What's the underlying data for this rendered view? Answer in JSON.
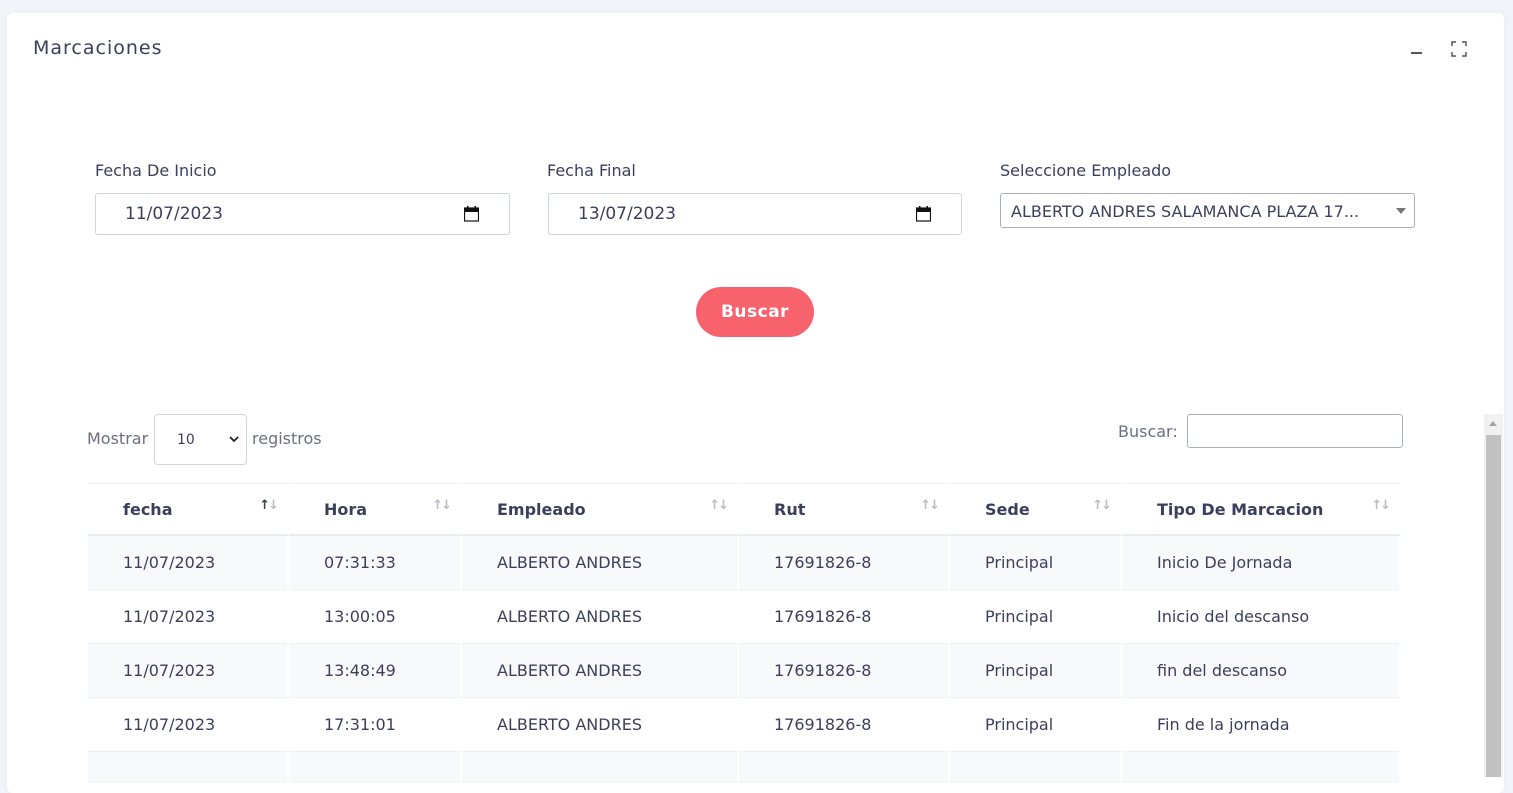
{
  "card": {
    "title": "Marcaciones"
  },
  "filters": {
    "start_label": "Fecha De Inicio",
    "start_value": "11/07/2023",
    "end_label": "Fecha Final",
    "end_value": "13/07/2023",
    "employee_label": "Seleccione Empleado",
    "employee_value": "ALBERTO ANDRES SALAMANCA PLAZA 17..."
  },
  "search_button": "Buscar",
  "table_controls": {
    "show_label": "Mostrar",
    "length_value": "10",
    "records_label": "registros",
    "search_label": "Buscar:"
  },
  "table": {
    "columns": [
      "fecha",
      "Hora",
      "Empleado",
      "Rut",
      "Sede",
      "Tipo De Marcacion"
    ],
    "rows": [
      [
        "11/07/2023",
        "07:31:33",
        "ALBERTO ANDRES",
        "17691826-8",
        "Principal",
        "Inicio De Jornada"
      ],
      [
        "11/07/2023",
        "13:00:05",
        "ALBERTO ANDRES",
        "17691826-8",
        "Principal",
        "Inicio del descanso"
      ],
      [
        "11/07/2023",
        "13:48:49",
        "ALBERTO ANDRES",
        "17691826-8",
        "Principal",
        "fin del descanso"
      ],
      [
        "11/07/2023",
        "17:31:01",
        "ALBERTO ANDRES",
        "17691826-8",
        "Principal",
        "Fin de la jornada"
      ]
    ],
    "sorted_column": "fecha"
  },
  "colors": {
    "accent": "#f8626c",
    "text": "#3b3f5c",
    "stripe": "#f8f9fb"
  },
  "icons": [
    "minimize-icon",
    "fullscreen-icon",
    "calendar-icon",
    "dropdown-caret-icon",
    "sort-icon"
  ]
}
